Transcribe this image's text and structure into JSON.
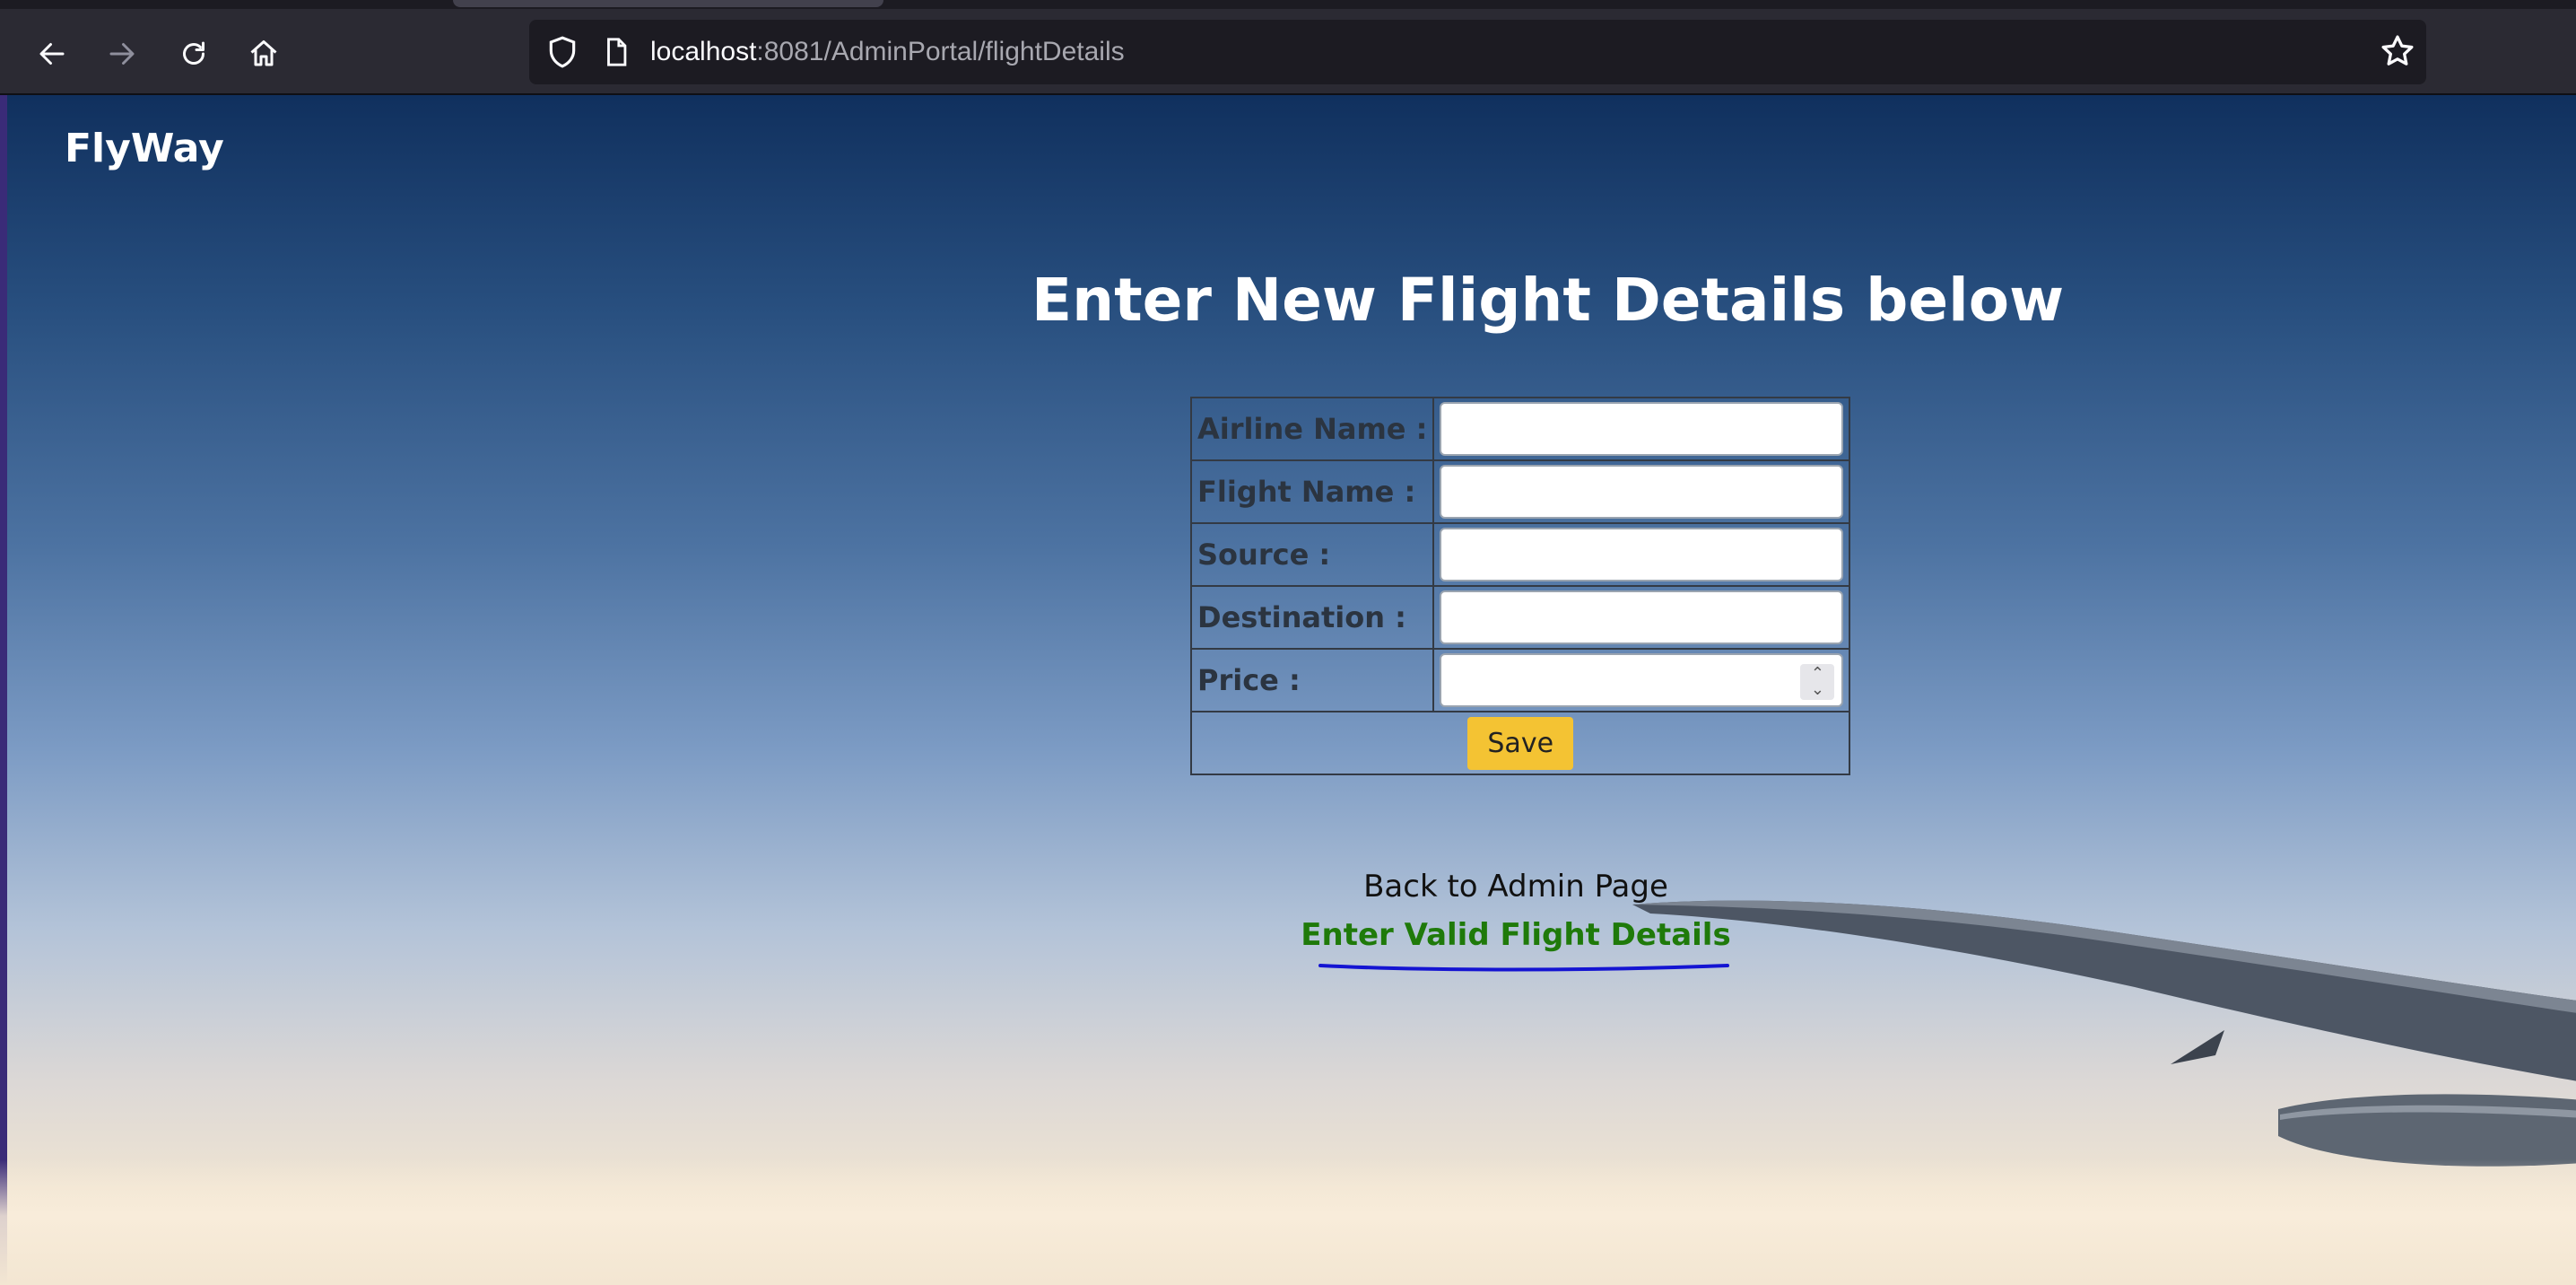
{
  "browser": {
    "url_host": "localhost",
    "url_path": ":8081/AdminPortal/flightDetails",
    "icons": [
      "back-arrow-icon",
      "forward-arrow-icon",
      "reload-icon",
      "home-icon",
      "shield-icon",
      "page-icon",
      "bookmark-star-icon"
    ]
  },
  "page": {
    "brand": "FlyWay",
    "title": "Enter New Flight Details below",
    "form": {
      "fields": [
        {
          "label": "Airline Name :",
          "value": ""
        },
        {
          "label": "Flight Name :",
          "value": ""
        },
        {
          "label": "Source :",
          "value": ""
        },
        {
          "label": "Destination :",
          "value": ""
        },
        {
          "label": "Price :",
          "value": ""
        }
      ],
      "save_label": "Save"
    },
    "back_link": "Back to Admin Page",
    "message": "Enter Valid Flight Details"
  },
  "colors": {
    "save_button": "#f4c333",
    "message": "#1f7a0a",
    "annotation_underline": "#1414d2"
  }
}
